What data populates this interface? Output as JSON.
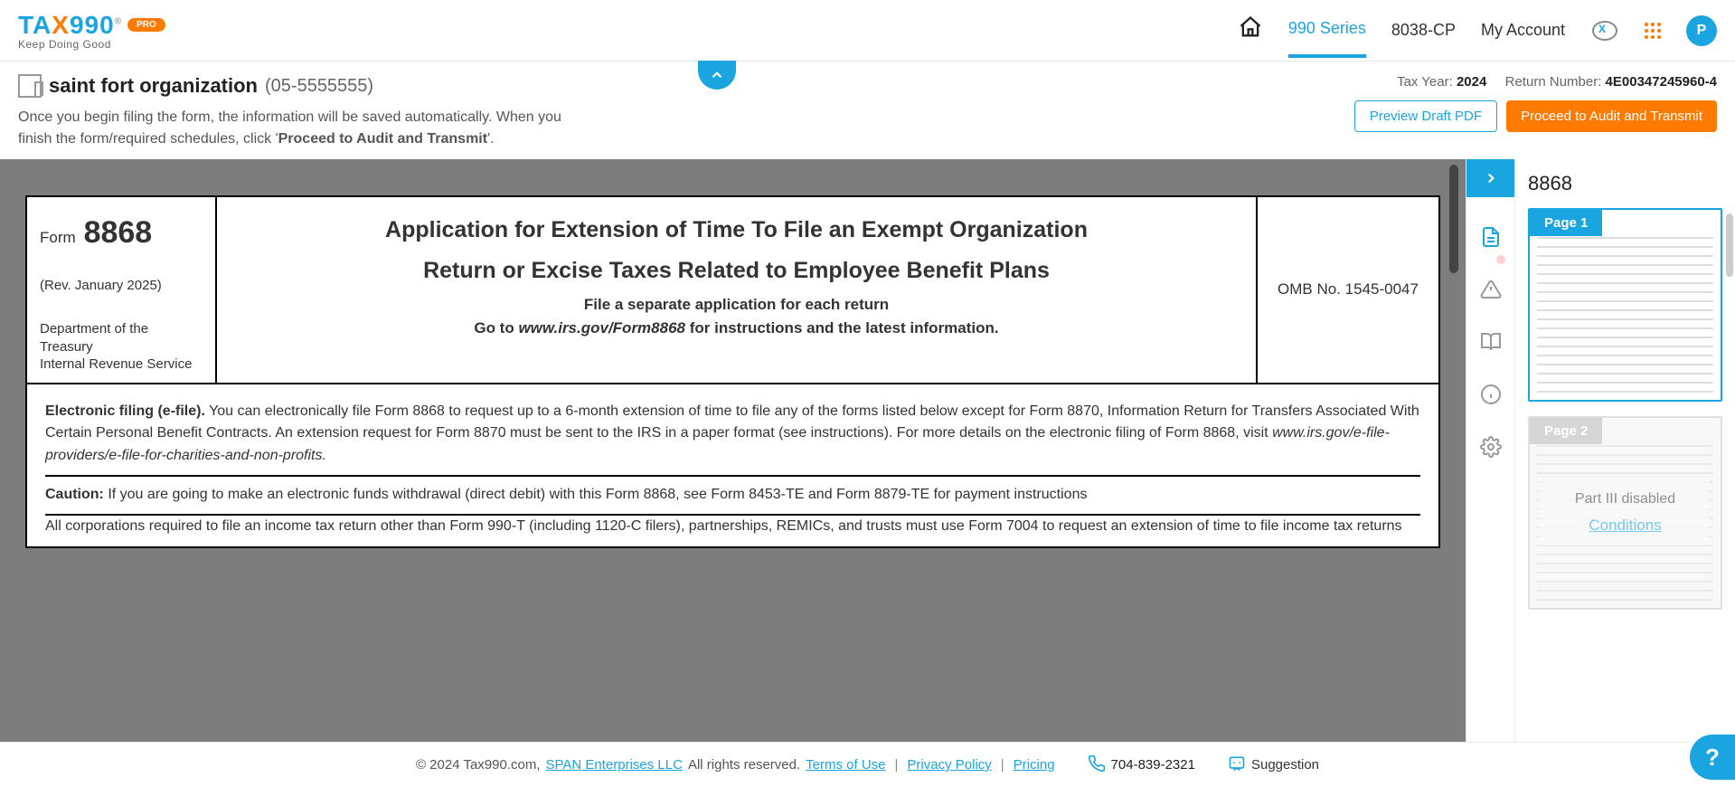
{
  "logo": {
    "tagline": "Keep Doing Good",
    "pro": "PRO"
  },
  "nav": {
    "series990": "990 Series",
    "cp8038": "8038-CP",
    "myaccount": "My Account",
    "avatar": "P"
  },
  "org": {
    "name": "saint fort organization",
    "ein": "(05-5555555)",
    "instruction_prefix": "Once you begin filing the form, the information will be saved automatically. When you finish the form/required schedules, click '",
    "instruction_bold": "Proceed to Audit and Transmit",
    "instruction_suffix": "'."
  },
  "meta": {
    "taxyear_label": "Tax Year: ",
    "taxyear": "2024",
    "return_label": "Return Number: ",
    "return_number": "4E00347245960-4"
  },
  "buttons": {
    "preview": "Preview Draft PDF",
    "proceed": "Proceed to Audit and Transmit"
  },
  "form": {
    "form_label": "Form",
    "number": "8868",
    "rev": "(Rev. January 2025)",
    "dept1": "Department of the Treasury",
    "dept2": "Internal Revenue Service",
    "title1": "Application for Extension of Time To File an Exempt Organization",
    "title2": "Return or Excise Taxes Related to Employee Benefit Plans",
    "sub1": "File a separate application for each return",
    "sub2_a": "Go to ",
    "sub2_b": "www.irs.gov/Form8868",
    "sub2_c": " for instructions and the latest information.",
    "omb": "OMB No. 1545-0047",
    "efile_label": "Electronic filing (e-file).",
    "efile_text_a": " You can electronically file Form 8868 to request up to a 6-month extension of time to file any of the forms listed below except for Form 8870, Information Return for Transfers Associated With Certain Personal Benefit Contracts. An extension request for Form 8870 must be sent to the IRS in a paper format (see instructions). For more details on the electronic filing of Form 8868, visit ",
    "efile_text_b": "www.irs.gov/e-file-providers/e-file-for-charities-and-non-profits.",
    "caution_label": "Caution:",
    "caution_text": " If you are going to make an electronic funds withdrawal (direct debit) with this Form 8868, see Form 8453-TE and Form 8879-TE for payment instructions",
    "corp_text": "All corporations required to file an income tax return other than Form 990-T (including 1120-C filers), partnerships, REMICs, and trusts must use Form 7004 to request an extension of time to file income tax returns"
  },
  "thumbs": {
    "title": "8868",
    "page1": "Page 1",
    "page2": "Page 2",
    "disabled_text": "Part III disabled",
    "conditions": "Conditions"
  },
  "footer": {
    "copyright": "© 2024 Tax990.com, ",
    "span": "SPAN Enterprises LLC",
    "rights": " All rights reserved. ",
    "terms": "Terms of Use",
    "privacy": "Privacy Policy",
    "pricing": "Pricing",
    "phone": "704-839-2321",
    "suggestion": "Suggestion"
  }
}
